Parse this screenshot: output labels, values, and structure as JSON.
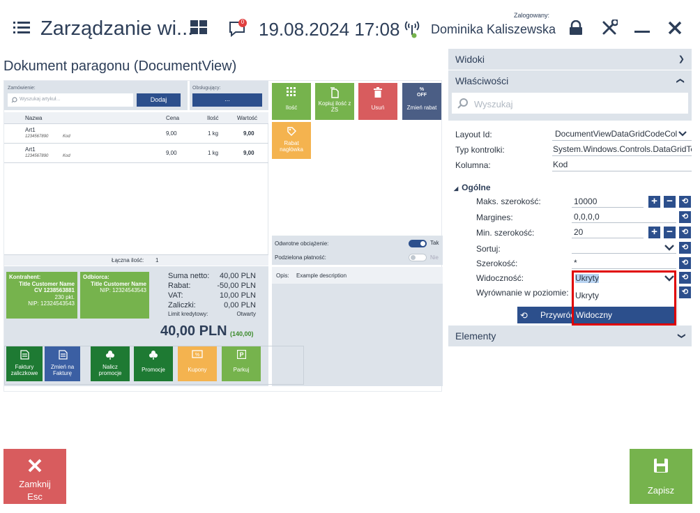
{
  "header": {
    "title": "Zarządzanie wi...",
    "datetime": "19.08.2024 17:08",
    "notification_count": "0",
    "logged_label": "Zalogowany:",
    "user": "Dominika Kaliszewska"
  },
  "page_title": "Dokument paragonu (DocumentView)",
  "order": {
    "label": "Zamówienie:",
    "search_placeholder": "Wyszukaj artykuł...",
    "add_button": "Dodaj",
    "served_label": "Obsługujący:",
    "served_value": "..."
  },
  "table": {
    "headers": [
      "Nazwa",
      "Cena",
      "Ilość",
      "Wartość"
    ],
    "rows": [
      {
        "name": "Art1",
        "ean": "1234567890",
        "kod": "Kod",
        "price": "9,00",
        "qty": "1 kg",
        "value": "9,00"
      },
      {
        "name": "Art1",
        "ean": "1234567890",
        "kod": "Kod",
        "price": "9,00",
        "qty": "1 kg",
        "value": "9,00"
      }
    ],
    "total_qty_label": "Łączna ilość:",
    "total_qty": "1"
  },
  "tiles": {
    "ilosc": "Ilość",
    "kopiuj": "Kopiuj ilość z ZS",
    "usun": "Usuń",
    "zmien_rabat": "Zmień rabat",
    "off": "% OFF",
    "rabat_naglowka": "Rabat nagłówka"
  },
  "toggles": {
    "reverse_label": "Odwrotne obciążenie:",
    "reverse_value": "Tak",
    "split_label": "Podzielona płatność:",
    "split_value": "Nie"
  },
  "desc": {
    "label": "Opis:",
    "value": "Example description"
  },
  "contractor": {
    "title": "Kontrahent:",
    "name": "Title Customer Name",
    "code": "CV 1238563881",
    "points": "230 pkt.",
    "nip": "NIP: 12324543543"
  },
  "recipient": {
    "title": "Odbiorca:",
    "name": "Title Customer Name",
    "nip": "NIP: 12324543543"
  },
  "summary": {
    "labels": [
      "Suma netto:",
      "Rabat:",
      "VAT:",
      "Zaliczki:",
      "Limit kredytowy:"
    ],
    "values": [
      "40,00 PLN",
      "-50,00 PLN",
      "10,00 PLN",
      "0,00 PLN",
      "Otwarty"
    ],
    "total": "40,00 PLN",
    "total_sub": "(140,00)"
  },
  "bottom_tiles": {
    "faktury": "Faktury zaliczkowe",
    "zmien": "Zmień na Fakturę",
    "nalicz": "Nalicz promocje",
    "promocje": "Promocje",
    "kupony": "Kupony",
    "parkuj": "Parkuj"
  },
  "footer": {
    "close": "Zamknij",
    "close_key": "Esc",
    "save": "Zapisz"
  },
  "panel": {
    "views": "Widoki",
    "properties": "Właściwości",
    "search_placeholder": "Wyszukaj",
    "elements": "Elementy",
    "layout_id_label": "Layout Id:",
    "layout_id": "DocumentViewDataGridCodeColu",
    "control_type_label": "Typ kontrolki:",
    "control_type": "System.Windows.Controls.DataGridTemp",
    "column_label": "Kolumna:",
    "column": "Kod",
    "general": "Ogólne",
    "max_width_label": "Maks. szerokość:",
    "max_width": "10000",
    "margins_label": "Margines:",
    "margins": "0,0,0,0",
    "min_width_label": "Min. szerokość:",
    "min_width": "20",
    "sort_label": "Sortuj:",
    "width_label": "Szerokość:",
    "width": "*",
    "visibility_label": "Widoczność:",
    "visibility": "Ukryty",
    "halign_label": "Wyrównanie w poziomie:",
    "restore": "Przywróć",
    "options": [
      "Ukryty",
      "Widoczny"
    ]
  },
  "colors": {
    "accent": "#2c4f8c",
    "highlight": "#e00000",
    "green": "#76b34d",
    "red": "#d85c5e"
  }
}
